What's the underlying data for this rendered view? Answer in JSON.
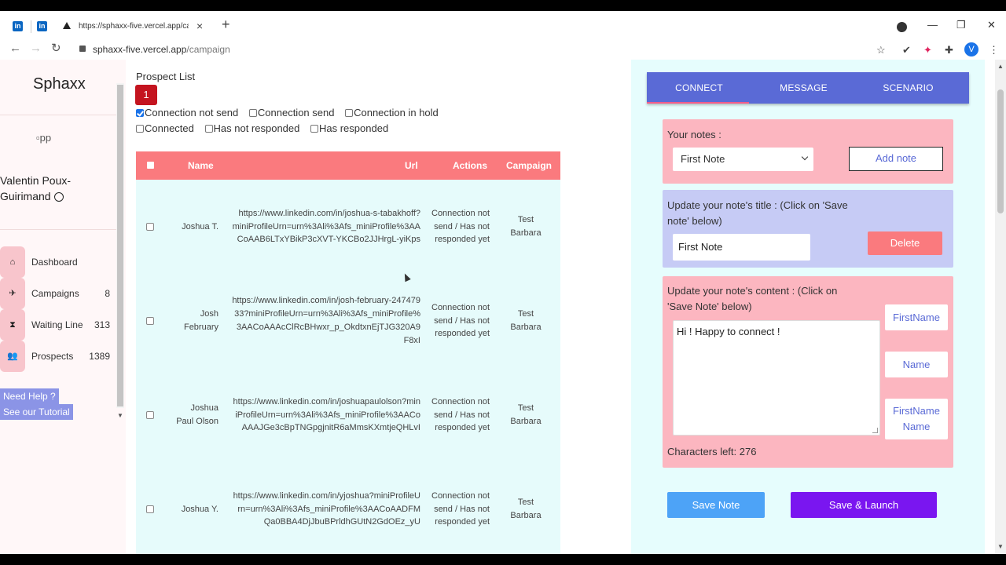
{
  "browser": {
    "tab_title": "https://sphaxx-five.vercel.app/ca",
    "url_host": "sphaxx-five.vercel.app",
    "url_path": "/campaign",
    "profile_initial": "V"
  },
  "sidebar": {
    "app_title": "Sphaxx",
    "image_alt": "pp",
    "user_name_line1": "Valentin Poux-",
    "user_name_line2": "Guirimand",
    "items": [
      {
        "label": "Dashboard",
        "count": "",
        "icon": "home-icon"
      },
      {
        "label": "Campaigns",
        "count": "8",
        "icon": "rocket-icon"
      },
      {
        "label": "Waiting Line",
        "count": "313",
        "icon": "hourglass-icon"
      },
      {
        "label": "Prospects",
        "count": "1389",
        "icon": "people-icon"
      }
    ],
    "help_line1": "Need Help ?",
    "help_line2": "See our Tutorial"
  },
  "main": {
    "title": "Prospect List",
    "badge": "1",
    "filters": [
      {
        "label": "Connection not send",
        "checked": true
      },
      {
        "label": "Connection send",
        "checked": false
      },
      {
        "label": "Connection in hold",
        "checked": false
      },
      {
        "label": "Connected",
        "checked": false
      },
      {
        "label": "Has not responded",
        "checked": false
      },
      {
        "label": "Has responded",
        "checked": false
      }
    ],
    "table": {
      "headers": {
        "name": "Name",
        "url": "Url",
        "actions": "Actions",
        "campaign": "Campaign"
      },
      "rows": [
        {
          "name": "Joshua T.",
          "url": "https://www.linkedin.com/in/joshua-s-tabakhoff?miniProfileUrn=urn%3Ali%3Afs_miniProfile%3AACoAAB6LTxYBikP3cXVT-YKCBo2JJHrgL-yiKps",
          "action": "Connection not send / Has not responded yet",
          "campaign": "Test Barbara"
        },
        {
          "name": "Josh February",
          "url": "https://www.linkedin.com/in/josh-february-24747933?miniProfileUrn=urn%3Ali%3Afs_miniProfile%3AACoAAAcClRcBHwxr_p_OkdtxnEjTJG320A9F8xI",
          "action": "Connection not send / Has not responded yet",
          "campaign": "Test Barbara"
        },
        {
          "name": "Joshua Paul Olson",
          "url": "https://www.linkedin.com/in/joshuapaulolson?miniProfileUrn=urn%3Ali%3Afs_miniProfile%3AACoAAAJGe3cBpTNGpgjnitR6aMmsKXmtjeQHLvI",
          "action": "Connection not send / Has not responded yet",
          "campaign": "Test Barbara"
        },
        {
          "name": "Joshua Y.",
          "url": "https://www.linkedin.com/in/yjoshua?miniProfileUrn=urn%3Ali%3Afs_miniProfile%3AACoAADFMQa0BBA4DjJbuBPrldhGUtN2GdOEz_yU",
          "action": "Connection not send / Has not responded yet",
          "campaign": "Test Barbara"
        }
      ]
    }
  },
  "panel": {
    "tabs": [
      "CONNECT",
      "MESSAGE",
      "SCENARIO"
    ],
    "notes_label": "Your notes :",
    "notes_selected": "First Note",
    "add_note": "Add note",
    "title_label_line1": "Update your note's title : (Click on 'Save",
    "title_label_line2": "note' below)",
    "title_value": "First Note",
    "delete": "Delete",
    "content_label_line1": "Update your note's content : (Click on",
    "content_label_line2": "'Save Note' below)",
    "content_value": "Hi ! Happy to connect !",
    "var_firstname": "FirstName",
    "var_name": "Name",
    "var_full_line1": "FirstName",
    "var_full_line2": "Name",
    "chars_left": "Characters left: 276",
    "save_note": "Save Note",
    "save_launch": "Save & Launch"
  },
  "colors": {
    "accent": "#5a6ad6",
    "table_header": "#fa7a7e",
    "card_pink": "#fcb6c0",
    "card_lavender": "#c6cbf5",
    "launch": "#7a16f0"
  }
}
